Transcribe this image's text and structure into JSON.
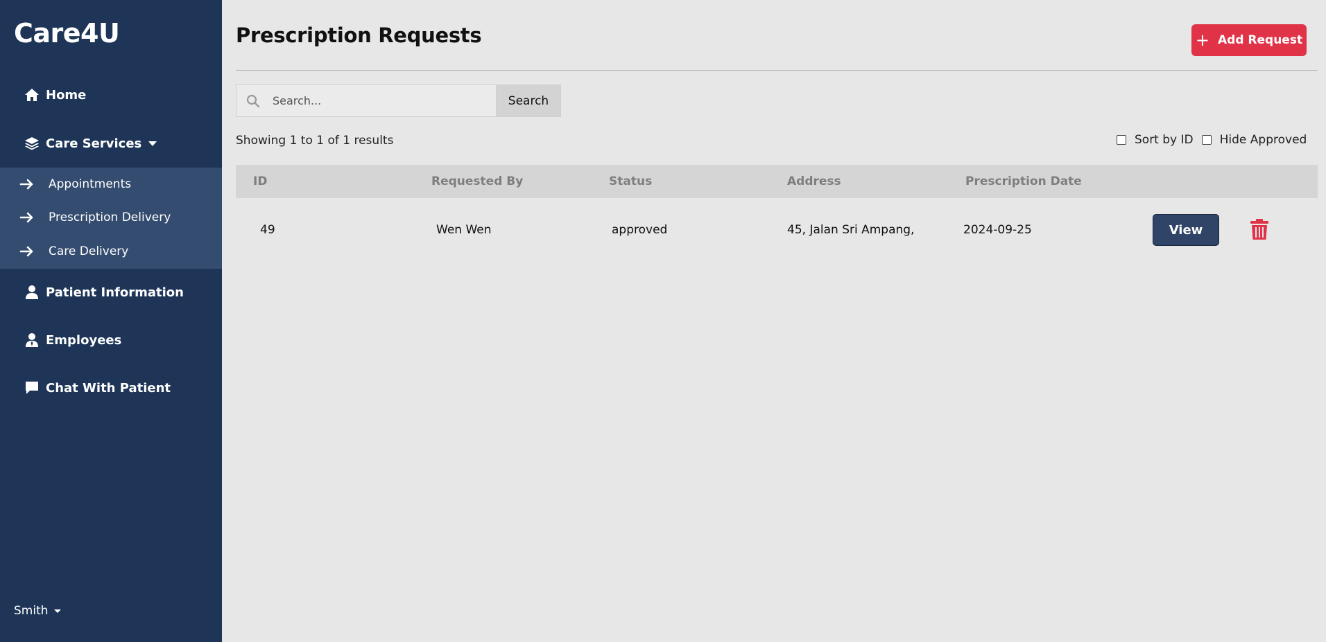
{
  "sidebar": {
    "brand": "Care4U",
    "items": [
      {
        "label": "Home",
        "icon": "home-icon"
      },
      {
        "label": "Care Services",
        "icon": "layers-icon"
      },
      {
        "label": "Patient Information",
        "icon": "user-icon"
      },
      {
        "label": "Employees",
        "icon": "employee-icon"
      },
      {
        "label": "Chat With Patient",
        "icon": "chat-icon"
      }
    ],
    "submenu": [
      {
        "label": "Appointments",
        "icon": "arrow-right-icon"
      },
      {
        "label": "Prescription Delivery",
        "icon": "arrow-right-icon"
      },
      {
        "label": "Care Delivery",
        "icon": "arrow-right-icon"
      }
    ],
    "user": "Smith"
  },
  "header": {
    "title": "Prescription Requests",
    "add_button": "Add Request"
  },
  "search": {
    "placeholder": "Search...",
    "button": "Search"
  },
  "results_text": "Showing 1 to 1 of 1 results",
  "filters": {
    "sort_by_id": "Sort by ID",
    "hide_approved": "Hide Approved"
  },
  "table": {
    "columns": [
      "ID",
      "Requested By",
      "Status",
      "Address",
      "Prescription Date"
    ],
    "rows": [
      {
        "id": "49",
        "requested_by": "Wen Wen",
        "status": "approved",
        "address": "45, Jalan Sri Ampang,",
        "date": "2024-09-25",
        "action": "View"
      }
    ]
  },
  "colors": {
    "sidebar": "#1e3557",
    "submenu": "#344c6f",
    "accent": "#e03348",
    "view_button": "#2f4466"
  }
}
